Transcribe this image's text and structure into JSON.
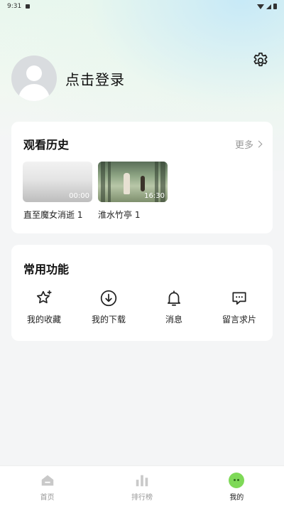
{
  "status_bar": {
    "time": "9:31"
  },
  "profile": {
    "login_label": "点击登录"
  },
  "history": {
    "title": "观看历史",
    "more_label": "更多",
    "items": [
      {
        "title": "直至魔女消逝 1",
        "duration": "00:00"
      },
      {
        "title": "淮水竹亭 1",
        "duration": "16:30"
      }
    ]
  },
  "functions": {
    "title": "常用功能",
    "items": [
      {
        "label": "我的收藏",
        "icon": "star-icon"
      },
      {
        "label": "我的下载",
        "icon": "download-icon"
      },
      {
        "label": "消息",
        "icon": "bell-icon"
      },
      {
        "label": "留言求片",
        "icon": "message-icon"
      }
    ]
  },
  "bottom_nav": {
    "items": [
      {
        "label": "首页",
        "icon": "home-icon",
        "active": false
      },
      {
        "label": "排行榜",
        "icon": "ranking-icon",
        "active": false
      },
      {
        "label": "我的",
        "icon": "me-icon",
        "active": true
      }
    ]
  },
  "colors": {
    "accent": "#7ed957",
    "background": "#f4f5f6",
    "card": "#ffffff",
    "muted": "#999999"
  }
}
